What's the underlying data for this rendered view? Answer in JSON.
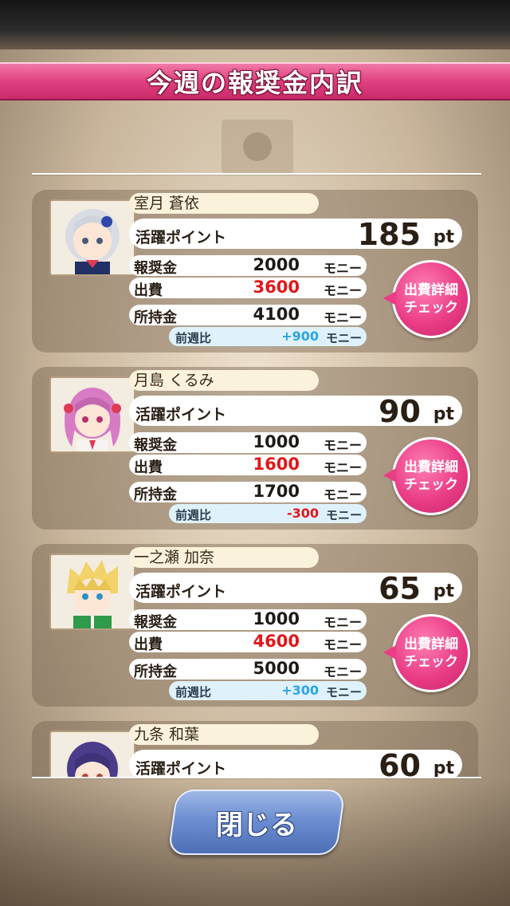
{
  "title": "今週の報奨金内訳",
  "labels": {
    "activity": "活躍ポイント",
    "reward": "報奨金",
    "expense": "出費",
    "balance": "所持金",
    "prev_week": "前週比",
    "unit_money": "モニー",
    "unit_pt": "pt",
    "detail_line1": "出費詳細",
    "detail_line2": "チェック"
  },
  "characters": [
    {
      "name": "室月 蒼依",
      "points": "185",
      "reward": "2000",
      "expense": "3600",
      "balance": "4100",
      "diff": "+900",
      "hair_color": "#d9dde3",
      "accent_color": "#3048a8"
    },
    {
      "name": "月島 くるみ",
      "points": "90",
      "reward": "1000",
      "expense": "1600",
      "balance": "1700",
      "diff": "-300",
      "hair_color": "#d77bc4",
      "accent_color": "#e03a55"
    },
    {
      "name": "一之瀬 加奈",
      "points": "65",
      "reward": "1000",
      "expense": "4600",
      "balance": "5000",
      "diff": "+300",
      "hair_color": "#f1d36a",
      "accent_color": "#2f9a49"
    },
    {
      "name": "九条 和葉",
      "points": "60",
      "hair_color": "#4b3d8a",
      "accent_color": "#4b3d8a"
    }
  ],
  "close_button": "閉じる",
  "colors": {
    "banner": "#e0407f",
    "expense_text": "#e2161a",
    "diff_positive": "#29a6e6",
    "diff_negative": "#e2161a",
    "close_button": "#6d8ed1"
  }
}
